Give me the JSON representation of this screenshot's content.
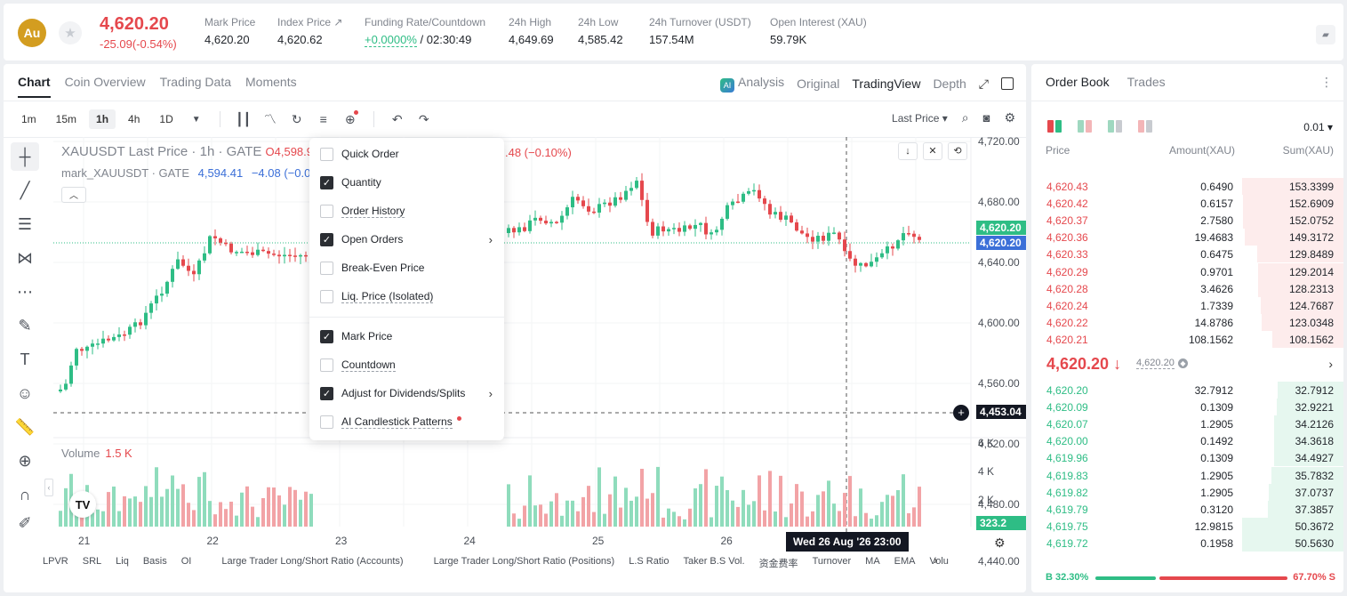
{
  "header": {
    "coin": "Au",
    "last_price": "4,620.20",
    "change": "-25.09(-0.54%)",
    "stats": [
      {
        "label": "Mark Price",
        "value": "4,620.20"
      },
      {
        "label": "Index Price ↗",
        "value": "4,620.62"
      },
      {
        "label": "Funding Rate/Countdown",
        "value_green": "+0.0000%",
        "value": " / 02:30:49"
      },
      {
        "label": "24h High",
        "value": "4,649.69"
      },
      {
        "label": "24h Low",
        "value": "4,585.42"
      },
      {
        "label": "24h Turnover (USDT)",
        "value": "157.54M"
      },
      {
        "label": "Open Interest (XAU)",
        "value": "59.79K"
      }
    ]
  },
  "chart_tabs": [
    "Chart",
    "Coin Overview",
    "Trading Data",
    "Moments"
  ],
  "view_tabs": {
    "analysis": "Analysis",
    "original": "Original",
    "tradingview": "TradingView",
    "depth": "Depth"
  },
  "timeframes": [
    "1m",
    "15m",
    "1h",
    "4h",
    "1D"
  ],
  "price_type": "Last Price ▾",
  "legend": {
    "line1": "XAUUSDT Last Price · 1h · GATE",
    "open": "O4,598.9",
    "change_tail": ".48 (−0.10%)",
    "line2": "mark_XAUUSDT · GATE",
    "mark_val": "4,594.41",
    "mark_chg": "−4.08 (−0.09%)"
  },
  "y_axis": [
    "4,720.00",
    "4,680.00",
    "4,640.00",
    "4,600.00",
    "4,560.00",
    "4,520.00",
    "4,480.00",
    "4,440.00"
  ],
  "price_tags": {
    "last": "4,620.20",
    "mark": "4,620.20",
    "cursor": "4,453.04",
    "volume": "323.2"
  },
  "volume": {
    "label": "Volume",
    "value": "1.5 K",
    "axis": [
      "6 K",
      "4 K",
      "2 K"
    ]
  },
  "x_axis": [
    "21",
    "22",
    "23",
    "24",
    "25",
    "26"
  ],
  "time_tag": "Wed 26 Aug '26   23:00",
  "bottom_indicators": [
    "LPVR",
    "SRL",
    "Liq",
    "Basis",
    "OI",
    "Large Trader Long/Short Ratio (Accounts)",
    "Large Trader Long/Short Ratio (Positions)",
    "L.S Ratio",
    "Taker B.S Vol.",
    "资金费率",
    "Turnover",
    "MA",
    "EMA",
    "Volu"
  ],
  "dropdown": [
    {
      "label": "Quick Order",
      "checked": false
    },
    {
      "label": "Quantity",
      "checked": true
    },
    {
      "label": "Order History",
      "checked": false
    },
    {
      "label": "Open Orders",
      "checked": true,
      "arrow": true
    },
    {
      "label": "Break-Even Price",
      "checked": false
    },
    {
      "label": "Liq. Price (Isolated)",
      "checked": false
    },
    {
      "label": "Mark Price",
      "checked": true
    },
    {
      "label": "Countdown",
      "checked": false
    },
    {
      "label": "Adjust for Dividends/Splits",
      "checked": true,
      "arrow": true
    },
    {
      "label": "AI Candlestick Patterns",
      "checked": false,
      "dot": true
    }
  ],
  "order_book": {
    "tabs": [
      "Order Book",
      "Trades"
    ],
    "precision": "0.01 ▾",
    "columns": {
      "price": "Price",
      "amount": "Amount(XAU)",
      "sum": "Sum(XAU)"
    },
    "asks": [
      {
        "price": "4,620.43",
        "amount": "0.6490",
        "sum": "153.3399",
        "depth": 1.0
      },
      {
        "price": "4,620.42",
        "amount": "0.6157",
        "sum": "152.6909",
        "depth": 0.995
      },
      {
        "price": "4,620.37",
        "amount": "2.7580",
        "sum": "152.0752",
        "depth": 0.99
      },
      {
        "price": "4,620.36",
        "amount": "19.4683",
        "sum": "149.3172",
        "depth": 0.975
      },
      {
        "price": "4,620.33",
        "amount": "0.6475",
        "sum": "129.8489",
        "depth": 0.85
      },
      {
        "price": "4,620.29",
        "amount": "0.9701",
        "sum": "129.2014",
        "depth": 0.845
      },
      {
        "price": "4,620.28",
        "amount": "3.4626",
        "sum": "128.2313",
        "depth": 0.84
      },
      {
        "price": "4,620.24",
        "amount": "1.7339",
        "sum": "124.7687",
        "depth": 0.815
      },
      {
        "price": "4,620.22",
        "amount": "14.8786",
        "sum": "123.0348",
        "depth": 0.805
      },
      {
        "price": "4,620.21",
        "amount": "108.1562",
        "sum": "108.1562",
        "depth": 0.705
      }
    ],
    "mid": {
      "price": "4,620.20 ↓",
      "mark": "4,620.20"
    },
    "bids": [
      {
        "price": "4,620.20",
        "amount": "32.7912",
        "sum": "32.7912",
        "depth": 0.65
      },
      {
        "price": "4,620.09",
        "amount": "0.1309",
        "sum": "32.9221",
        "depth": 0.655
      },
      {
        "price": "4,620.07",
        "amount": "1.2905",
        "sum": "34.2126",
        "depth": 0.68
      },
      {
        "price": "4,620.00",
        "amount": "0.1492",
        "sum": "34.3618",
        "depth": 0.683
      },
      {
        "price": "4,619.96",
        "amount": "0.1309",
        "sum": "34.4927",
        "depth": 0.686
      },
      {
        "price": "4,619.83",
        "amount": "1.2905",
        "sum": "35.7832",
        "depth": 0.71
      },
      {
        "price": "4,619.82",
        "amount": "1.2905",
        "sum": "37.0737",
        "depth": 0.737
      },
      {
        "price": "4,619.79",
        "amount": "0.3120",
        "sum": "37.3857",
        "depth": 0.743
      },
      {
        "price": "4,619.75",
        "amount": "12.9815",
        "sum": "50.3672",
        "depth": 1.0
      },
      {
        "price": "4,619.72",
        "amount": "0.1958",
        "sum": "50.5630",
        "depth": 1.0
      }
    ],
    "ratio": {
      "buy": "B 32.30%",
      "sell": "67.70% S",
      "buy_fraction": 0.323
    }
  },
  "colors": {
    "up": "#2ebd85",
    "down": "#e5484d",
    "mark_line": "#3b6fd8"
  }
}
